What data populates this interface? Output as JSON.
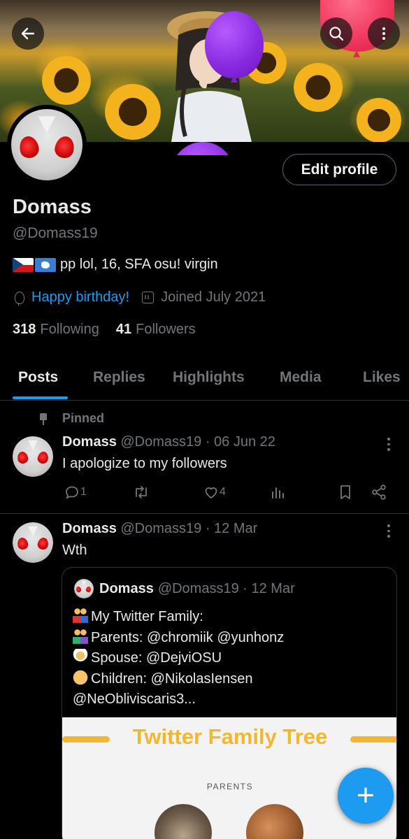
{
  "header": {
    "back_icon": "arrow-left-icon",
    "search_icon": "search-icon",
    "more_icon": "more-vertical-icon"
  },
  "profile": {
    "display_name": "Domass",
    "handle": "@Domass19",
    "bio": "pp lol, 16, SFA osu! virgin",
    "birthday": "Happy birthday!",
    "joined": "Joined July 2021",
    "following_count": "318",
    "following_label": "Following",
    "followers_count": "41",
    "followers_label": "Followers",
    "edit_button": "Edit profile"
  },
  "tabs": [
    {
      "label": "Posts",
      "active": true
    },
    {
      "label": "Replies",
      "active": false
    },
    {
      "label": "Highlights",
      "active": false
    },
    {
      "label": "Media",
      "active": false
    },
    {
      "label": "Likes",
      "active": false
    }
  ],
  "posts": [
    {
      "pinned_label": "Pinned",
      "name": "Domass",
      "meta": "@Domass19 · 06 Jun 22",
      "text": "I apologize to my followers",
      "replies": "1",
      "likes": "4"
    },
    {
      "name": "Domass",
      "meta": "@Domass19 · 12 Mar",
      "text": "Wth",
      "quote": {
        "name": "Domass",
        "meta": "@Domass19 · 12 Mar",
        "lines": [
          "My Twitter Family:",
          "Parents: @chromiik @yunhonz",
          "Spouse: @DejviOSU",
          "Children: @NikolasIensen",
          "@NeObliviscaris3..."
        ],
        "image_title": "Twitter Family Tree",
        "image_section": "PARENTS"
      }
    }
  ],
  "fab_label": "+",
  "colors": {
    "accent": "#1d9bf0",
    "secondary_text": "#71767b",
    "tree_title": "#f2b630"
  }
}
